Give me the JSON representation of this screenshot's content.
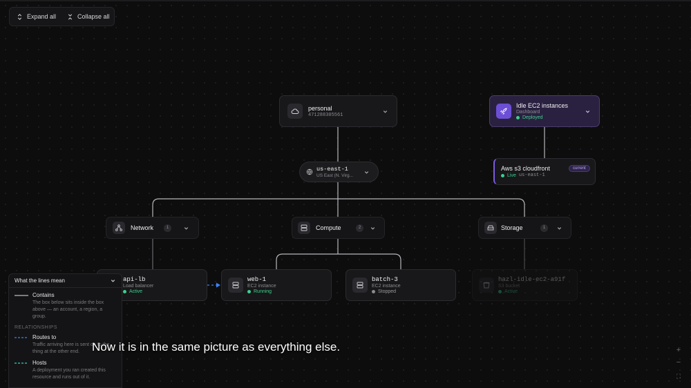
{
  "toolbar": {
    "expand_label": "Expand all",
    "collapse_label": "Collapse all"
  },
  "account": {
    "name": "personal",
    "id": "471288305561"
  },
  "dashboard": {
    "title": "Idle EC2 instances",
    "subtitle": "Dashboard",
    "status": "Deployed"
  },
  "cdn": {
    "title": "Aws s3 cloudfront",
    "badge": "current",
    "status": "Live",
    "region": "us-east-1"
  },
  "region": {
    "code": "us-east-1",
    "name": "US East (N. Virg..."
  },
  "groups": [
    {
      "label": "Network",
      "count": "1"
    },
    {
      "label": "Compute",
      "count": "2"
    },
    {
      "label": "Storage",
      "count": "1"
    }
  ],
  "resources": {
    "api": {
      "name": "api-lb",
      "type": "Load balancer",
      "status": "Active"
    },
    "web": {
      "name": "web-1",
      "type": "EC2 instance",
      "status": "Running"
    },
    "batch": {
      "name": "batch-3",
      "type": "EC2 instance",
      "status": "Stopped"
    },
    "s3": {
      "name": "hazl-idle-ec2-a91f",
      "type": "S3 bucket",
      "status": "Active"
    }
  },
  "legend": {
    "title": "What the lines mean",
    "contains_title": "Contains",
    "contains_desc": "The box below sits inside the box above — an account, a region, a group.",
    "section": "RELATIONSHIPS",
    "routes_title": "Routes to",
    "routes_desc": "Traffic arriving here is sent on to the thing at the other end.",
    "hosts_title": "Hosts",
    "hosts_desc": "A deployment you ran created this resource and runs out of it."
  },
  "caption": "Now it is in the same picture as everything else.",
  "zoom": {
    "in": "+",
    "out": "−",
    "fit": "⛶"
  },
  "colors": {
    "status_green": "#3ecf8e",
    "status_gray": "#8a8a8f",
    "route_blue": "#3b82f6",
    "host_teal": "#2dd4bf",
    "accent_purple": "#8b5cf6"
  }
}
